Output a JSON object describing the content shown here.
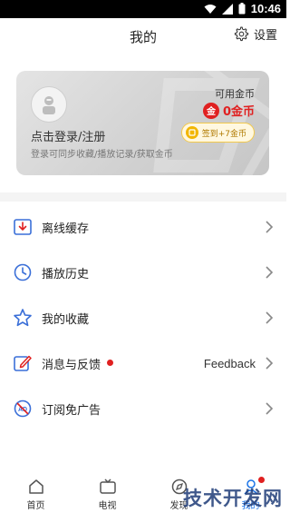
{
  "status_bar": {
    "time": "10:46"
  },
  "header": {
    "title": "我的",
    "settings_label": "设置"
  },
  "login_card": {
    "title": "点击登录/注册",
    "subtitle": "登录可同步收藏/播放记录/获取金币",
    "coin_label": "可用金币",
    "coin_amount": "0金币",
    "coin_badge": "金",
    "checkin_label": "签到+7金币"
  },
  "menu": [
    {
      "label": "离线缓存",
      "icon": "download-icon",
      "value": ""
    },
    {
      "label": "播放历史",
      "icon": "clock-icon",
      "value": ""
    },
    {
      "label": "我的收藏",
      "icon": "star-icon",
      "value": ""
    },
    {
      "label": "消息与反馈",
      "icon": "edit-icon",
      "value": "Feedback",
      "has_dot": true
    },
    {
      "label": "订阅免广告",
      "icon": "no-ad-icon",
      "value": ""
    }
  ],
  "bottom_nav": [
    {
      "label": "首页",
      "icon": "home-icon",
      "active": false
    },
    {
      "label": "电视",
      "icon": "tv-icon",
      "active": false
    },
    {
      "label": "发现",
      "icon": "discover-icon",
      "active": false
    },
    {
      "label": "我的",
      "icon": "profile-icon",
      "active": true
    }
  ],
  "watermark": "技术开发网",
  "colors": {
    "accent": "#1a73e8",
    "alert": "#e02020",
    "gold": "#f2b600"
  }
}
